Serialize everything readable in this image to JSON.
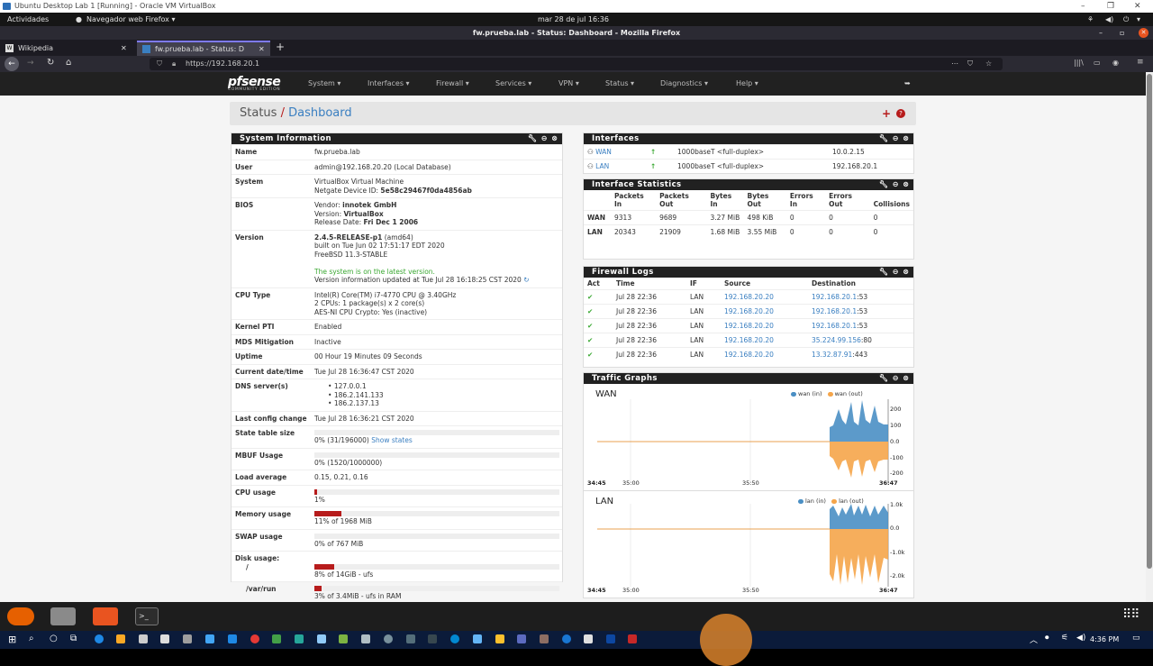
{
  "vm_window": {
    "title": "Ubuntu Desktop Lab 1 [Running] - Oracle VM VirtualBox"
  },
  "gnome_bar": {
    "activities": "Actividades",
    "app_menu": "Navegador web Firefox",
    "clock": "mar 28 de jul  16:36"
  },
  "firefox": {
    "window_title": "fw.prueba.lab - Status: Dashboard - Mozilla Firefox",
    "tabs": [
      {
        "label": "Wikipedia",
        "active": false
      },
      {
        "label": "fw.prueba.lab - Status: D",
        "active": true
      }
    ],
    "url": "https://192.168.20.1"
  },
  "pfsense_nav": {
    "logo": "pfsense",
    "logo_sub": "COMMUNITY EDITION",
    "menus": [
      "System",
      "Interfaces",
      "Firewall",
      "Services",
      "VPN",
      "Status",
      "Diagnostics",
      "Help"
    ]
  },
  "breadcrumb": {
    "section": "Status",
    "separator": "/",
    "page": "Dashboard"
  },
  "system_info": {
    "title": "System Information",
    "name": "fw.prueba.lab",
    "user": "admin@192.168.20.20 (Local Database)",
    "system_line1": "VirtualBox Virtual Machine",
    "system_ndi_label": "Netgate Device ID:",
    "system_ndi": "5e58c29467f0da4856ab",
    "bios_vendor_label": "Vendor:",
    "bios_vendor": "innotek GmbH",
    "bios_version_label": "Version:",
    "bios_version": "VirtualBox",
    "bios_date_label": "Release Date:",
    "bios_date": "Fri Dec 1 2006",
    "version_bold": "2.4.5-RELEASE-p1",
    "version_arch": "(amd64)",
    "version_built": "built on Tue Jun 02 17:51:17 EDT 2020",
    "version_os": "FreeBSD 11.3-STABLE",
    "version_status": "The system is on the latest version.",
    "version_updated": "Version information updated at Tue Jul 28 16:18:25 CST 2020",
    "cpu_type_1": "Intel(R) Core(TM) i7-4770 CPU @ 3.40GHz",
    "cpu_type_2": "2 CPUs: 1 package(s) x 2 core(s)",
    "cpu_type_3": "AES-NI CPU Crypto: Yes (inactive)",
    "kernel_pti": "Enabled",
    "mds": "Inactive",
    "uptime": "00 Hour 19 Minutes 09 Seconds",
    "datetime": "Tue Jul 28 16:36:47 CST 2020",
    "dns": [
      "127.0.0.1",
      "186.2.141.133",
      "186.2.137.13"
    ],
    "last_config": "Tue Jul 28 16:36:21 CST 2020",
    "state_table": "0% (31/196000)",
    "show_states": "Show states",
    "mbuf": "0% (1520/1000000)",
    "load": "0.15, 0.21, 0.16",
    "cpu_usage": "1%",
    "cpu_usage_frac": 0.01,
    "memory": "11% of 1968 MiB",
    "memory_frac": 0.11,
    "swap": "0% of 767 MiB",
    "swap_frac": 0,
    "disk_root": "8% of 14GiB - ufs",
    "disk_root_frac": 0.08,
    "disk_varrun": "3% of 3.4MiB - ufs in RAM",
    "disk_varrun_frac": 0.03,
    "labels": {
      "name": "Name",
      "user": "User",
      "system": "System",
      "bios": "BIOS",
      "version": "Version",
      "cpu_type": "CPU Type",
      "kernel_pti": "Kernel PTI",
      "mds": "MDS Mitigation",
      "uptime": "Uptime",
      "datetime": "Current date/time",
      "dns": "DNS server(s)",
      "last_config": "Last config change",
      "state_table": "State table size",
      "mbuf": "MBUF Usage",
      "load": "Load average",
      "cpu_usage": "CPU usage",
      "memory": "Memory usage",
      "swap": "SWAP usage",
      "disk": "Disk usage:",
      "disk_root": "/",
      "disk_varrun": "/var/run"
    }
  },
  "interfaces": {
    "title": "Interfaces",
    "rows": [
      {
        "name": "WAN",
        "media": "1000baseT <full-duplex>",
        "ip": "10.0.2.15"
      },
      {
        "name": "LAN",
        "media": "1000baseT <full-duplex>",
        "ip": "192.168.20.1"
      }
    ]
  },
  "interface_stats": {
    "title": "Interface Statistics",
    "headers": [
      "Packets In",
      "Packets Out",
      "Bytes In",
      "Bytes Out",
      "Errors In",
      "Errors Out",
      "Collisions"
    ],
    "rows": [
      {
        "name": "WAN",
        "values": [
          "9313",
          "9689",
          "3.27 MiB",
          "498 KiB",
          "0",
          "0",
          "0"
        ]
      },
      {
        "name": "LAN",
        "values": [
          "20343",
          "21909",
          "1.68 MiB",
          "3.55 MiB",
          "0",
          "0",
          "0"
        ]
      }
    ]
  },
  "firewall_logs": {
    "title": "Firewall Logs",
    "headers": [
      "Act",
      "Time",
      "IF",
      "Source",
      "Destination"
    ],
    "rows": [
      {
        "time": "Jul 28 22:36",
        "if": "LAN",
        "src": "192.168.20.20",
        "dst_ip": "192.168.20.1",
        "dst_port": ":53"
      },
      {
        "time": "Jul 28 22:36",
        "if": "LAN",
        "src": "192.168.20.20",
        "dst_ip": "192.168.20.1",
        "dst_port": ":53"
      },
      {
        "time": "Jul 28 22:36",
        "if": "LAN",
        "src": "192.168.20.20",
        "dst_ip": "192.168.20.1",
        "dst_port": ":53"
      },
      {
        "time": "Jul 28 22:36",
        "if": "LAN",
        "src": "192.168.20.20",
        "dst_ip": "35.224.99.156",
        "dst_port": ":80"
      },
      {
        "time": "Jul 28 22:36",
        "if": "LAN",
        "src": "192.168.20.20",
        "dst_ip": "13.32.87.91",
        "dst_port": ":443"
      }
    ]
  },
  "traffic_graphs": {
    "title": "Traffic Graphs",
    "colors": {
      "in": "#4a8fc4",
      "out": "#f5a54a"
    },
    "graphs": [
      {
        "name": "WAN",
        "legend_in": "wan (in)",
        "legend_out": "wan (out)",
        "yticks": [
          "200",
          "100",
          "0.0",
          "-100",
          "-200"
        ],
        "xticks": [
          "34:45",
          "35:00",
          "35:50",
          "36:47"
        ]
      },
      {
        "name": "LAN",
        "legend_in": "lan (in)",
        "legend_out": "lan (out)",
        "yticks": [
          "1.0k",
          "0.0",
          "-1.0k",
          "-2.0k"
        ],
        "xticks": [
          "34:45",
          "35:00",
          "35:50",
          "36:47"
        ]
      }
    ]
  },
  "taskbar": {
    "time": "4:36 PM"
  }
}
